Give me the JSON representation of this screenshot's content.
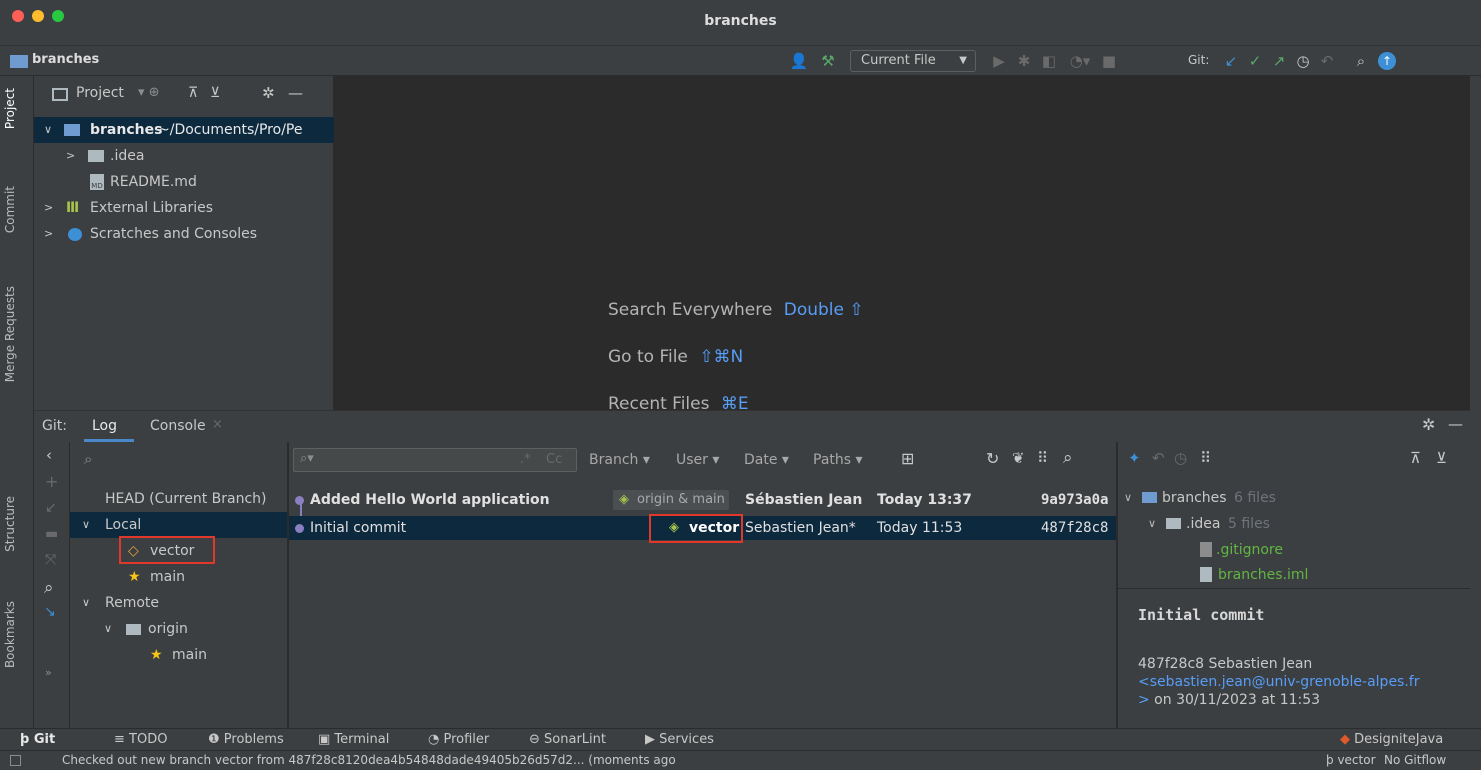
{
  "window": {
    "title": "branches"
  },
  "nav": {
    "project_name": "branches",
    "run_config": "Current File",
    "git_label": "Git:"
  },
  "left_tabs": {
    "project": "Project",
    "commit": "Commit",
    "merge_requests": "Merge Requests",
    "structure": "Structure",
    "bookmarks": "Bookmarks"
  },
  "project_panel": {
    "header": "Project",
    "tree": [
      {
        "label": "branches",
        "suffix": " ~/Documents/Pro/Pe"
      },
      {
        "label": ".idea"
      },
      {
        "label": "README.md"
      },
      {
        "label": "External Libraries"
      },
      {
        "label": "Scratches and Consoles"
      }
    ]
  },
  "editor_hints": [
    {
      "text": "Search Everywhere",
      "key": "Double ⇧"
    },
    {
      "text": "Go to File",
      "key": "⇧⌘N"
    },
    {
      "text": "Recent Files",
      "key": "⌘E"
    }
  ],
  "git_window": {
    "label": "Git:",
    "tabs": [
      "Log",
      "Console"
    ],
    "branches": {
      "head": "HEAD (Current Branch)",
      "local": "Local",
      "local_items": [
        "vector",
        "main"
      ],
      "remote": "Remote",
      "remote_group": "origin",
      "remote_items": [
        "main"
      ]
    },
    "filters": {
      "regex": ".*",
      "case": "Cc",
      "branch": "Branch",
      "user": "User",
      "date": "Date",
      "paths": "Paths"
    },
    "commits": [
      {
        "message": "Added Hello World application",
        "tags": "origin & main",
        "author": "Sébastien Jean",
        "date": "Today 13:37",
        "hash": "9a973a0a"
      },
      {
        "message": "Initial commit",
        "tags": "vector",
        "author": "Sebastien Jean*",
        "date": "Today 11:53",
        "hash": "487f28c8"
      }
    ],
    "details": {
      "root": "branches",
      "root_count": "6 files",
      "idea": ".idea",
      "idea_count": "5 files",
      "files": [
        ".gitignore",
        "branches.iml"
      ],
      "commit_title": "Initial commit",
      "commit_line": "487f28c8 Sebastien Jean",
      "email": "<sebastien.jean@univ-grenoble-alpes.fr",
      "email_end": ">",
      "date_line": " on 30/11/2023 at 11:53"
    }
  },
  "bottom_tabs": [
    "Git",
    "TODO",
    "Problems",
    "Terminal",
    "Profiler",
    "SonarLint",
    "Services"
  ],
  "bottom_right": "DesigniteJava",
  "status": {
    "message": "Checked out new branch vector from 487f28c8120dea4b54848dade49405b26d57d2... (moments ago",
    "branch": "vector",
    "gitflow": "No Gitflow"
  },
  "colors": {
    "accent": "#589df6",
    "highlight": "#e0392b",
    "selected_row": "#0d293e",
    "tag_green": "#a7c34d"
  }
}
